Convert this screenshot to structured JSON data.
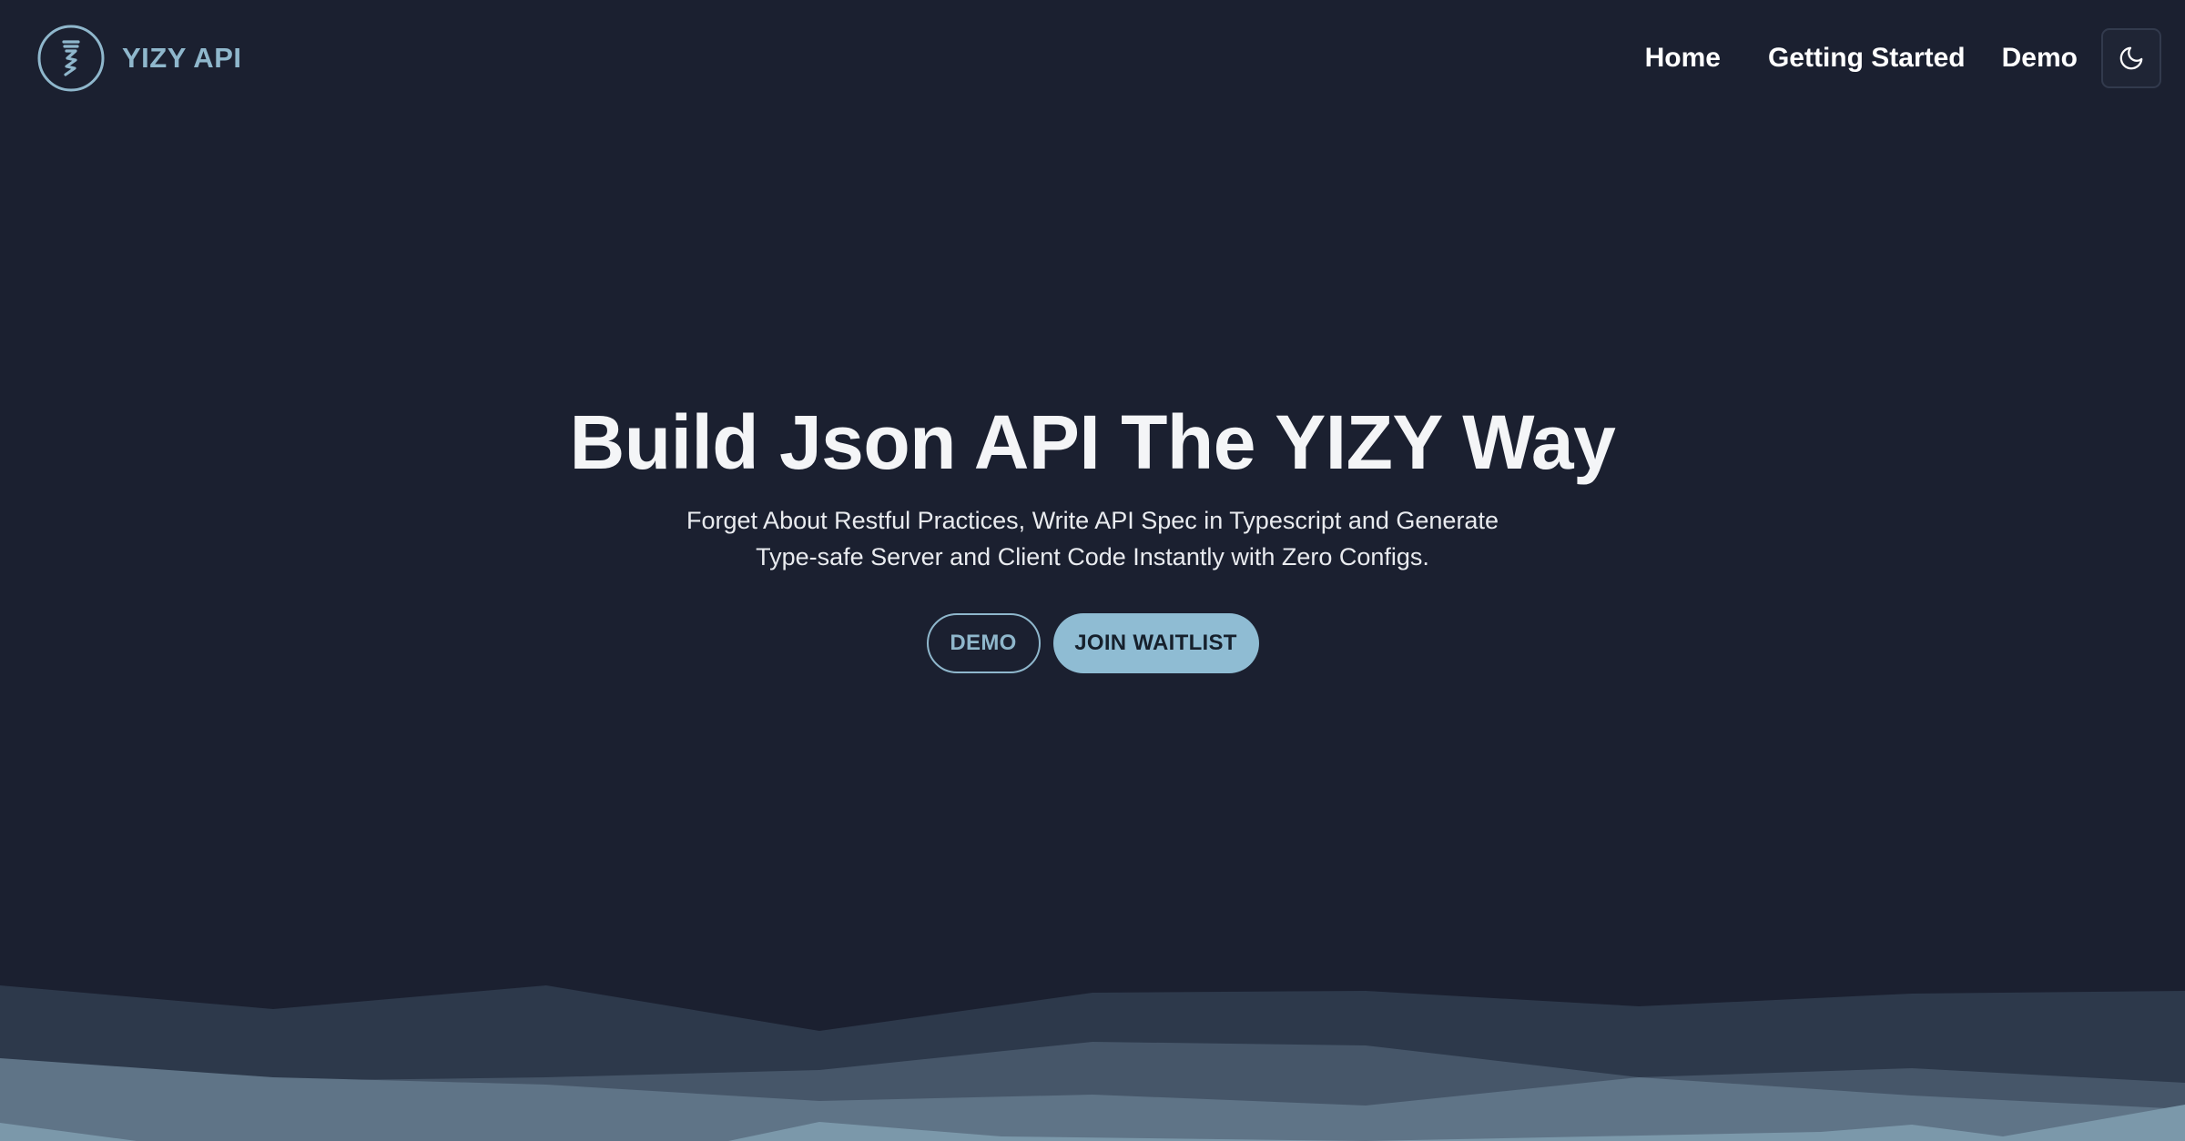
{
  "brand": {
    "name": "YIZY API",
    "logo_icon": "yizy-logo-icon"
  },
  "nav": {
    "home": "Home",
    "getting_started": "Getting Started",
    "demo": "Demo",
    "theme_toggle_icon": "moon-icon"
  },
  "hero": {
    "title": "Build Json API The YIZY Way",
    "subtitle": "Forget About Restful Practices, Write API Spec in Typescript and Generate Type-safe Server and Client Code Instantly with Zero Configs.",
    "demo_button": "DEMO",
    "waitlist_button": "JOIN WAITLIST"
  },
  "colors": {
    "background": "#1b2030",
    "accent": "#8fb7cc",
    "button_fill": "#8fbcd3",
    "wave_layers": [
      "#2d394b",
      "#465669",
      "#5f7487",
      "#7b98aa"
    ]
  }
}
